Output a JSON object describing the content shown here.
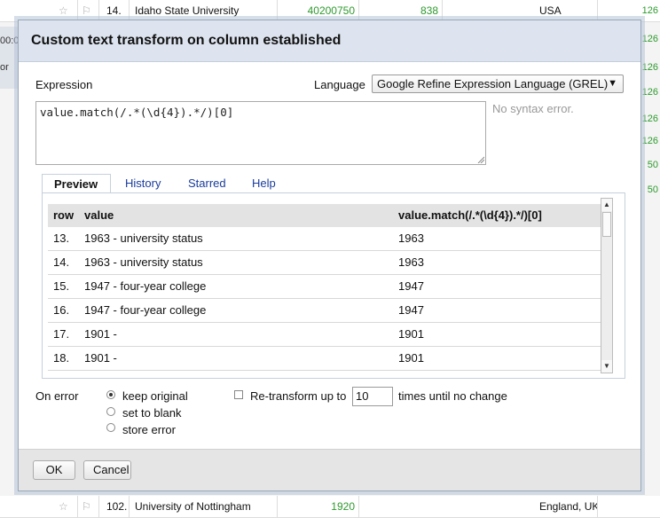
{
  "background": {
    "top_row": {
      "num": "14.",
      "name": "Idaho State University",
      "v1": "40200750",
      "v2": "838",
      "country": "USA"
    },
    "bottom_row": {
      "num": "102.",
      "name": "University of Nottingham",
      "v1": "1920",
      "country": "England, UK"
    },
    "left_texts": [
      "00:0",
      "or"
    ],
    "right_texts": [
      "126",
      "126",
      "126",
      "126",
      "126",
      "126",
      "50",
      "50"
    ]
  },
  "dialog": {
    "title": "Custom text transform on column established",
    "expression_label": "Expression",
    "language_label": "Language",
    "language_value": "Google Refine Expression Language (GREL)",
    "expression": "value.match(/.*(\\d{4}).*/)[0]",
    "syntax_status": "No syntax error.",
    "tabs": [
      "Preview",
      "History",
      "Starred",
      "Help"
    ],
    "preview": {
      "headers": [
        "row",
        "value",
        "value.match(/.*(\\d{4}).*/)[0]"
      ],
      "rows": [
        {
          "row": "13.",
          "value": "1963 - university status",
          "result": "1963"
        },
        {
          "row": "14.",
          "value": "1963 - university status",
          "result": "1963"
        },
        {
          "row": "15.",
          "value": "1947 - four-year college",
          "result": "1947"
        },
        {
          "row": "16.",
          "value": "1947 - four-year college",
          "result": "1947"
        },
        {
          "row": "17.",
          "value": "1901 -",
          "result": "1901"
        },
        {
          "row": "18.",
          "value": "1901 -",
          "result": "1901"
        }
      ]
    },
    "on_error_label": "On error",
    "on_error_options": [
      "keep original",
      "set to blank",
      "store error"
    ],
    "retransform_label": "Re-transform up to",
    "retransform_value": "10",
    "retransform_suffix": "times until no change",
    "ok_label": "OK",
    "cancel_label": "Cancel"
  }
}
